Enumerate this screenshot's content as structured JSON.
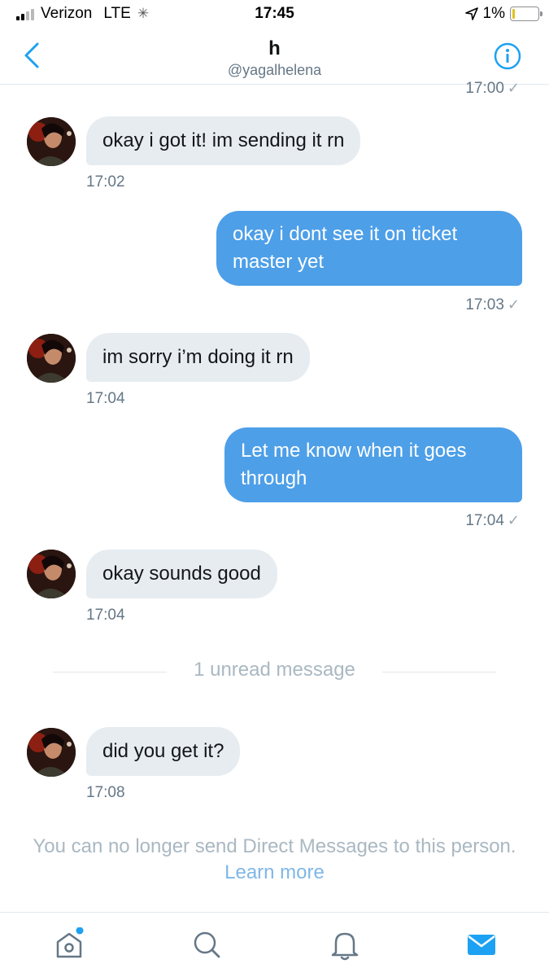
{
  "status_bar": {
    "carrier": "Verizon",
    "network": "LTE",
    "time": "17:45",
    "battery": "1%"
  },
  "header": {
    "title": "h",
    "handle": "@yagalhelena"
  },
  "top_timestamp": "17:00",
  "messages": [
    {
      "direction": "in",
      "text": "okay i got it! im sending it rn",
      "time": "17:02"
    },
    {
      "direction": "out",
      "lines": [
        "okay i dont see it on  ticket",
        "master yet"
      ],
      "time": "17:03"
    },
    {
      "direction": "in",
      "text": "im sorry i’m doing it rn",
      "time": "17:04"
    },
    {
      "direction": "out",
      "lines": [
        "Let me know when it goes",
        "through"
      ],
      "time": "17:04"
    },
    {
      "direction": "in",
      "text": "okay sounds good",
      "time": "17:04"
    },
    {
      "direction": "in",
      "text": "did you get it?",
      "time": "17:08"
    }
  ],
  "unread_divider": "1 unread message",
  "notice": {
    "text": "You can no longer send Direct Messages to this person.",
    "link": "Learn more"
  },
  "colors": {
    "accent": "#1da1f2",
    "outgoing_bubble": "#4d9fe8",
    "incoming_bubble": "#e6ecf0",
    "muted_text": "#aab8c2"
  },
  "tabs": [
    {
      "name": "home-icon",
      "badge": true
    },
    {
      "name": "search-icon",
      "badge": false
    },
    {
      "name": "notifications-icon",
      "badge": false
    },
    {
      "name": "messages-icon",
      "active": true
    }
  ]
}
